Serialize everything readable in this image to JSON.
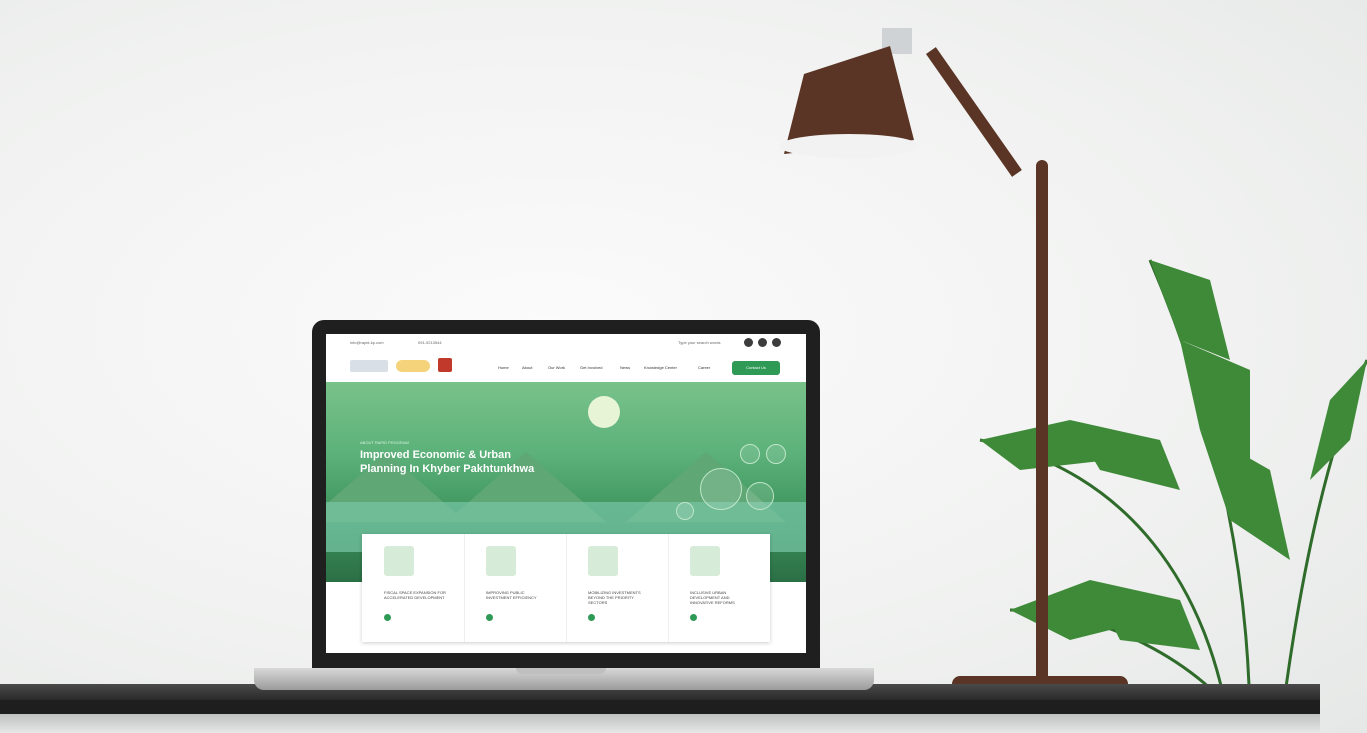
{
  "site": {
    "topbar": {
      "email": "info@rapid-kp.com",
      "phone": "091-9213544",
      "search_placeholder": "Type your search words"
    },
    "nav": {
      "items": [
        "Home",
        "About",
        "Our Work",
        "Get Involved",
        "News",
        "Knowledge Center",
        "Career"
      ],
      "contact_label": "Contact Us"
    },
    "hero": {
      "eyebrow": "ABOUT RAPID PROGRAM",
      "title": "Improved Economic & Urban Planning In Khyber Pakhtunkhwa"
    },
    "cards": [
      {
        "label": "FISCAL SPACE EXPANSION FOR ACCELERATED DEVELOPMENT"
      },
      {
        "label": "IMPROVING PUBLIC INVESTMENT EFFICIENCY"
      },
      {
        "label": "MOBILIZING INVESTMENTS BEYOND THE PRIORITY SECTORS"
      },
      {
        "label": "INCLUSIVE URBAN DEVELOPMENT AND INNOVATIVE REFORMS"
      }
    ]
  },
  "colors": {
    "accent": "#2e9a55",
    "lamp": "#5a3424",
    "table": "#2a2a2a"
  }
}
